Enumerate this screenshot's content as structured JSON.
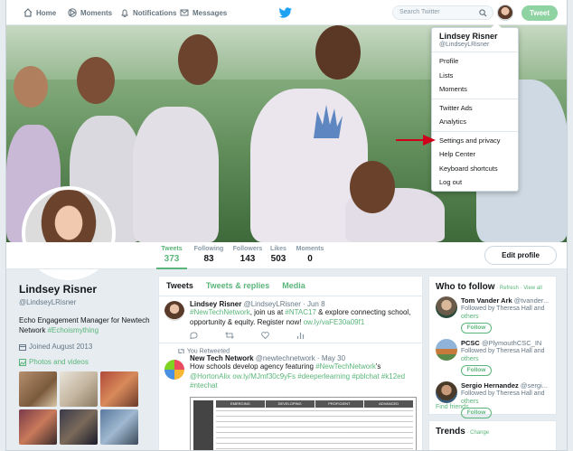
{
  "nav": {
    "home": "Home",
    "moments": "Moments",
    "notifications": "Notifications",
    "messages": "Messages",
    "search_placeholder": "Search Twitter",
    "tweet_button": "Tweet"
  },
  "stats": [
    {
      "label": "Tweets",
      "value": "373"
    },
    {
      "label": "Following",
      "value": "83"
    },
    {
      "label": "Followers",
      "value": "143"
    },
    {
      "label": "Likes",
      "value": "503"
    },
    {
      "label": "Moments",
      "value": "0"
    }
  ],
  "edit_profile": "Edit profile",
  "profile": {
    "name": "Lindsey Risner",
    "handle": "@LindseyLRisner",
    "bio_text": "Echo Engagement Manager for Newtech Network ",
    "bio_tag": "#Echoismything",
    "joined": "Joined August 2013",
    "photos_link": "Photos and videos"
  },
  "timeline": {
    "tab_tweets": "Tweets",
    "tab_replies": "Tweets & replies",
    "tab_media": "Media",
    "tweets": [
      {
        "name": "Lindsey Risner",
        "handle": "@LindseyLRisner · Jun 8",
        "tag": "#NewTechNetwork",
        "text_mid": ", join us at ",
        "tag2": "#NTAC17",
        "text_end": " & explore connecting school, opportunity & equity. Register now! ",
        "link": "ow.ly/vaFE30a09f1"
      },
      {
        "retweet_label": "You Retweeted",
        "name": "New Tech Network",
        "handle": "@newtechnetwork · May 30",
        "text_start": "How schools develop agency featuring ",
        "tag": "#NewTechNetwork",
        "text_mid": "'s ",
        "mention": "@HortonAlix",
        "link": "ow.ly/MJmf30c9yFs",
        "tags_end": " #deeperlearning #pblchat #k12ed #ntechat"
      }
    ],
    "doc_headers": [
      "EMERGING",
      "DEVELOPING",
      "PROFICIENT",
      "ADVANCED"
    ]
  },
  "who_to_follow": {
    "title": "Who to follow",
    "refresh": " · Refresh · View all",
    "people": [
      {
        "name": "Tom Vander Ark",
        "handle": "@tvander...",
        "followed_by": "Followed by Theresa Hall and ",
        "others": "others",
        "button": "Follow"
      },
      {
        "name": "PCSC",
        "handle": "@PlymouthCSC_IN",
        "followed_by": "Followed by Theresa Hall and ",
        "others": "others",
        "button": "Follow"
      },
      {
        "name": "Sergio Hernandez",
        "handle": "@sergi...",
        "followed_by": "Followed by Theresa Hall and ",
        "others": "others",
        "button": "Follow"
      }
    ],
    "find_friends": "Find friends"
  },
  "trends": {
    "title": "Trends",
    "change": " · Change"
  },
  "menu": {
    "name": "Lindsey Risner",
    "handle": "@LindseyLRisner",
    "items_a": [
      "Profile",
      "Lists",
      "Moments"
    ],
    "items_b": [
      "Twitter Ads",
      "Analytics"
    ],
    "items_c": [
      "Settings and privacy",
      "Help Center",
      "Keyboard shortcuts",
      "Log out"
    ]
  },
  "colors": {
    "accent": "#5ab57a",
    "tweet_button": "#8fd3a3",
    "arrow": "#d0021b"
  }
}
